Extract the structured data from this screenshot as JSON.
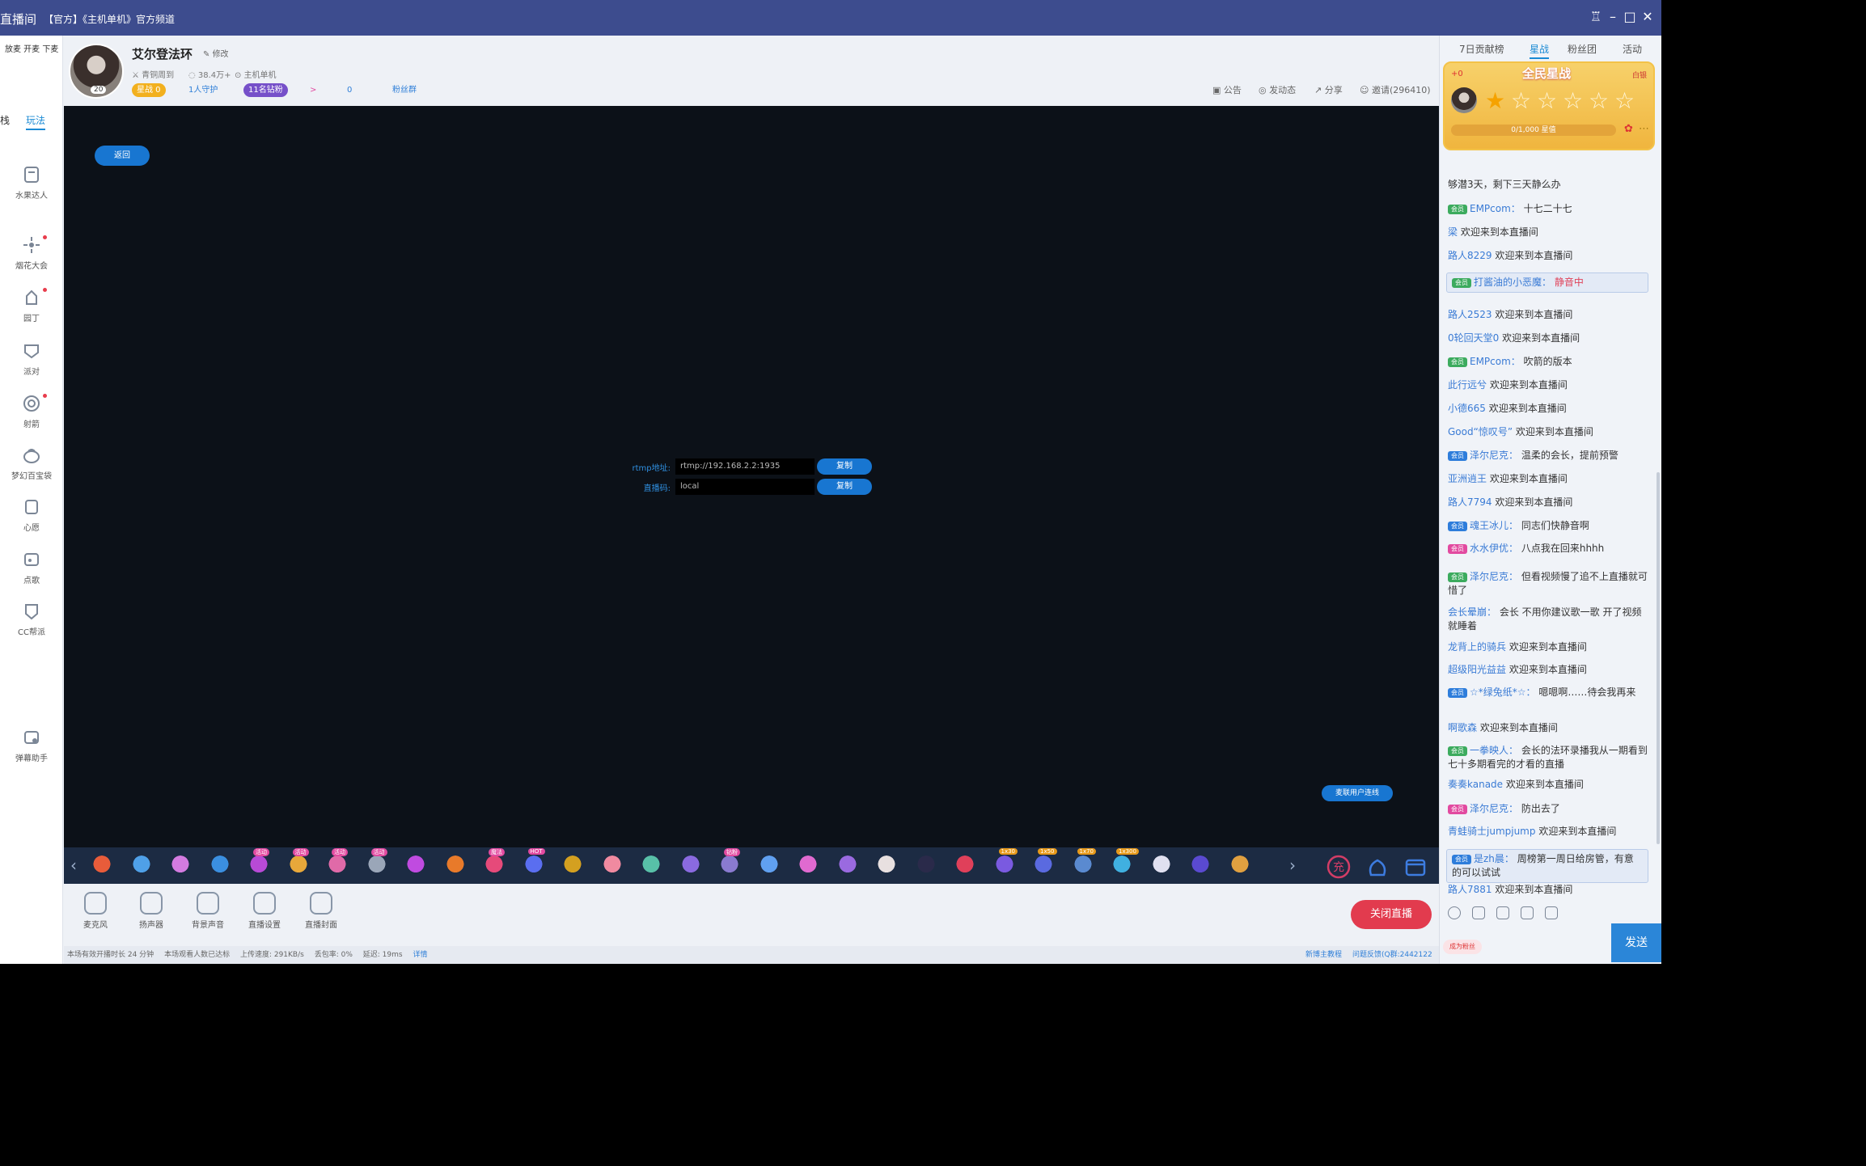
{
  "window": {
    "title": "直播间",
    "subtitle": "【官方】《主机单机》官方频道",
    "controls": {
      "minimize": "–",
      "maximize": "□",
      "close": "✕",
      "skin": "♖"
    }
  },
  "leftnav": {
    "top_text": "放麦 开麦 下麦",
    "tab_a": "栈",
    "tab_b": "玩法",
    "items": [
      {
        "label": "水果达人",
        "icon": "fruit-icon"
      },
      {
        "label": "烟花大会",
        "icon": "firework-icon"
      },
      {
        "label": "园丁",
        "icon": "gardener-icon"
      },
      {
        "label": "派对",
        "icon": "party-icon"
      },
      {
        "label": "射箭",
        "icon": "archery-icon"
      },
      {
        "label": "梦幻百宝袋",
        "icon": "treasure-bag-icon"
      },
      {
        "label": "心愿",
        "icon": "wish-icon"
      },
      {
        "label": "点歌",
        "icon": "song-icon"
      },
      {
        "label": "CC帮派",
        "icon": "clan-icon"
      },
      {
        "label": "弹幕助手",
        "icon": "danmaku-icon"
      }
    ]
  },
  "header": {
    "anchor_name": "艾尔登法环",
    "edit": "修改",
    "level": "20",
    "meta": [
      "青铜周到",
      "38.4万+",
      "主机单机"
    ],
    "chips": [
      "星战 0",
      "1人守护",
      "11名钻粉",
      ">",
      "0",
      "粉丝群"
    ],
    "tools": [
      "公告",
      "发动态",
      "分享",
      "邀请(296410)"
    ]
  },
  "stage": {
    "back": "返回",
    "rtmp_label": "rtmp地址:",
    "rtmp_value": "rtmp://192.168.2.2:1935",
    "key_label": "直播码:",
    "key_value": "local",
    "copy": "复制",
    "link_user": "麦联用户连线"
  },
  "giftbar": {
    "left_arrow": "‹",
    "right_arrow": "›",
    "badges": [
      "活动",
      "活动",
      "活动",
      "活动",
      "魔法",
      "HOT",
      "钻粉",
      "1x30",
      "1x50",
      "1x70",
      "1x300"
    ]
  },
  "controls": {
    "buttons": [
      "麦克风",
      "扬声器",
      "背景声音",
      "直播设置",
      "直播封面"
    ],
    "close_live": "关闭直播"
  },
  "status": {
    "duration": "本场有效开播时长 24 分钟",
    "audience": "本场观看人数已达标",
    "upload": "上传速度: 291KB/s",
    "loss": "丢包率: 0%",
    "latency": "延迟: 19ms",
    "detail": "详情",
    "tutorial": "新博主教程",
    "feedback": "问题反馈(Q群:2442122"
  },
  "right": {
    "tabs": [
      "7日贡献榜",
      "星战",
      "粉丝团",
      "活动"
    ],
    "star_title": "全民星战",
    "fire": "+0",
    "rule": "白银",
    "progress": "0/1,000 星值",
    "chat": [
      {
        "user": "",
        "text": "够潜3天，剩下三天静么办",
        "badge": ""
      },
      {
        "user": "EMPcom：",
        "text": "十七二十七",
        "badge": "会员"
      },
      {
        "user": "梁",
        "text": "欢迎来到本直播间",
        "badge": ""
      },
      {
        "user": "路人8229",
        "text": "欢迎来到本直播间",
        "badge": ""
      },
      {
        "user": "打酱油的小恶魔：",
        "text": "静音中",
        "badge": "会员"
      },
      {
        "user": "路人2523",
        "text": "欢迎来到本直播间",
        "badge": ""
      },
      {
        "user": "0轮回天堂0",
        "text": "欢迎来到本直播间",
        "badge": ""
      },
      {
        "user": "EMPcom：",
        "text": "吹箭的版本",
        "badge": "会员"
      },
      {
        "user": "此行远兮",
        "text": "欢迎来到本直播间",
        "badge": ""
      },
      {
        "user": "小德665",
        "text": "欢迎来到本直播间",
        "badge": ""
      },
      {
        "user": "Good“惊叹号”",
        "text": "欢迎来到本直播间",
        "badge": ""
      },
      {
        "user": "泽尔尼克：",
        "text": "温柔的会长，提前预警",
        "badge": "会员"
      },
      {
        "user": "亚洲逍王",
        "text": "欢迎来到本直播间",
        "badge": ""
      },
      {
        "user": "路人7794",
        "text": "欢迎来到本直播间",
        "badge": ""
      },
      {
        "user": "魂王冰儿：",
        "text": "同志们快静音啊",
        "badge": "会员"
      },
      {
        "user": "水水伊优：",
        "text": "八点我在回来hhhh",
        "badge": "会员"
      },
      {
        "user": "泽尔尼克：",
        "text": "但看视频慢了追不上直播就可惜了",
        "badge": "会员"
      },
      {
        "user": "会长晕崩：",
        "text": "会长 不用你建议歌一歌 开了视频就睡着",
        "badge": ""
      },
      {
        "user": "龙背上的骑兵",
        "text": "欢迎来到本直播间",
        "badge": ""
      },
      {
        "user": "超级阳光益益",
        "text": "欢迎来到本直播间",
        "badge": ""
      },
      {
        "user": "☆*绿兔纸*☆：",
        "text": "嗯嗯啊……待会我再来",
        "badge": "会员"
      },
      {
        "user": "啊歌森",
        "text": "欢迎来到本直播间",
        "badge": ""
      },
      {
        "user": "一拳映人：",
        "text": "会长的法环录播我从一期看到七十多期看完的才看的直播",
        "badge": "会员"
      },
      {
        "user": "奏奏kanade",
        "text": "欢迎来到本直播间",
        "badge": ""
      },
      {
        "user": "泽尔尼克：",
        "text": "防出去了",
        "badge": "会员"
      },
      {
        "user": "青蛙骑士jumpjump",
        "text": "欢迎来到本直播间",
        "badge": ""
      },
      {
        "user": "是zh晨：",
        "text": "周榜第一周日给房管，有意的可以试试",
        "badge": "会员"
      },
      {
        "user": "路人7881",
        "text": "欢迎来到本直播间",
        "badge": ""
      }
    ],
    "become_fan": "成为粉丝",
    "send": "发送"
  }
}
